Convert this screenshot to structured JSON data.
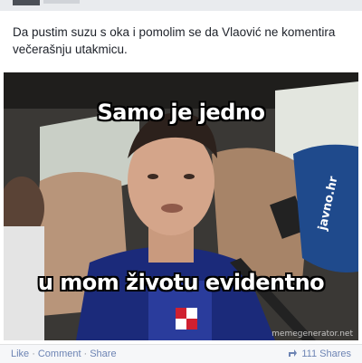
{
  "post": {
    "text": "Da pustim suzu s oka i pomolim se da Vlaović ne komentira večerašnju utakmicu."
  },
  "meme": {
    "top_text": "Samo je jedno",
    "bottom_text": "u mom životu evidentno",
    "mic_label": "javno.hr",
    "watermark": "memegenerator.net"
  },
  "actions": {
    "like": "Like",
    "comment": "Comment",
    "share": "Share",
    "separator": "·",
    "shares_count": "111 Shares"
  },
  "colors": {
    "link": "#6d84b4",
    "text": "#1d2129",
    "bar_bg": "#f6f7f9"
  }
}
